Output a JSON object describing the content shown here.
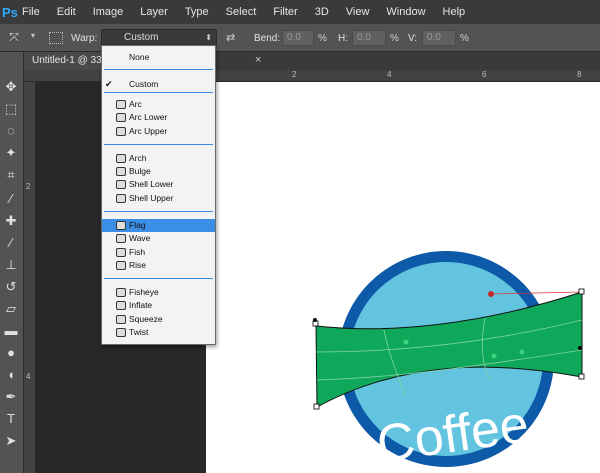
{
  "app": {
    "logo": "Ps"
  },
  "menu": [
    "File",
    "Edit",
    "Image",
    "Layer",
    "Type",
    "Select",
    "Filter",
    "3D",
    "View",
    "Window",
    "Help"
  ],
  "options": {
    "warp_label": "Warp:",
    "warp_value": "Custom",
    "bend_label": "Bend:",
    "bend_value": "0.0",
    "h_label": "H:",
    "h_value": "0.0",
    "v_label": "V:",
    "v_value": "0.0",
    "pct": "%"
  },
  "tab": {
    "title": "Untitled-1 @ 33",
    "close": "×"
  },
  "ruler_top": [
    "2",
    "4",
    "6",
    "8"
  ],
  "ruler_left": [
    "2",
    "4"
  ],
  "warp_menu": {
    "items": [
      {
        "label": "None",
        "group": 0
      },
      {
        "label": "Custom",
        "group": 1,
        "checked": true
      },
      {
        "label": "Arc",
        "group": 2
      },
      {
        "label": "Arc Lower",
        "group": 2
      },
      {
        "label": "Arc Upper",
        "group": 2
      },
      {
        "label": "Arch",
        "group": 3
      },
      {
        "label": "Bulge",
        "group": 3
      },
      {
        "label": "Shell Lower",
        "group": 3
      },
      {
        "label": "Shell Upper",
        "group": 3
      },
      {
        "label": "Flag",
        "group": 4,
        "selected": true
      },
      {
        "label": "Wave",
        "group": 4
      },
      {
        "label": "Fish",
        "group": 4
      },
      {
        "label": "Rise",
        "group": 4
      },
      {
        "label": "Fisheye",
        "group": 5
      },
      {
        "label": "Inflate",
        "group": 5
      },
      {
        "label": "Squeeze",
        "group": 5
      },
      {
        "label": "Twist",
        "group": 5
      }
    ]
  },
  "artwork": {
    "text": "Coffee"
  },
  "colors": {
    "accent": "#3a8ee6",
    "ring": "#0d5aa8",
    "circle": "#63c4e0",
    "banner": "#0fa85a"
  }
}
